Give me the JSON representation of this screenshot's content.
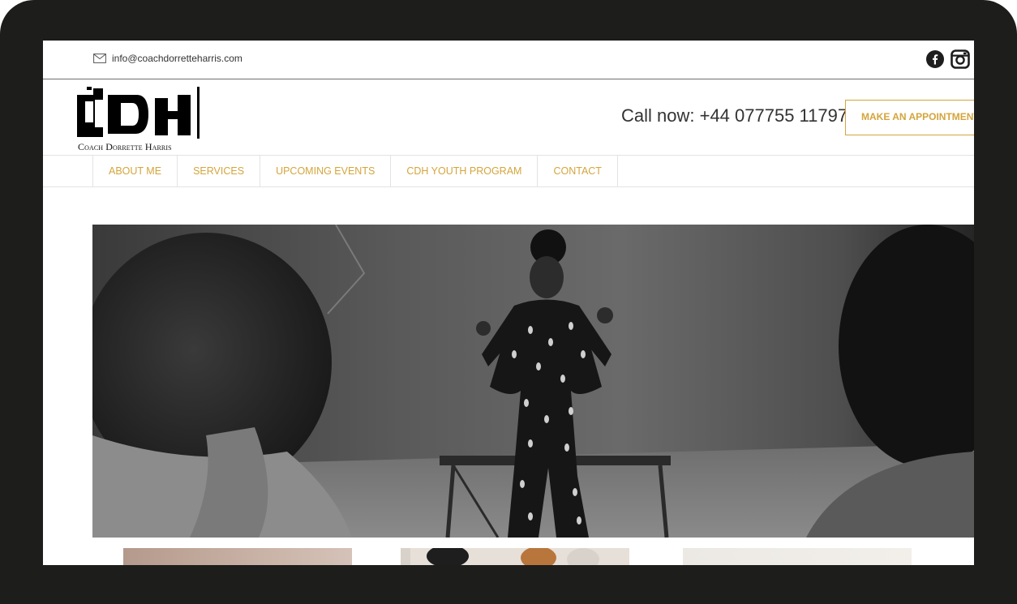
{
  "topbar": {
    "email": "info@coachdorretteharris.com",
    "email_icon": "mail-icon",
    "social": [
      "facebook-icon",
      "instagram-icon"
    ]
  },
  "header": {
    "logo_letters": "CDH",
    "logo_subtitle": "Coach Dorrette Harris",
    "call_text": "Call now: +44 077755 11797",
    "appointment_label": "MAKE AN APPOINTMENT"
  },
  "nav": {
    "items": [
      "ABOUT ME",
      "SERVICES",
      "UPCOMING EVENTS",
      "CDH YOUTH PROGRAM",
      "CONTACT"
    ]
  },
  "colors": {
    "frame": "#1d1d1c",
    "accent": "#d4a53c",
    "text": "#333333"
  }
}
